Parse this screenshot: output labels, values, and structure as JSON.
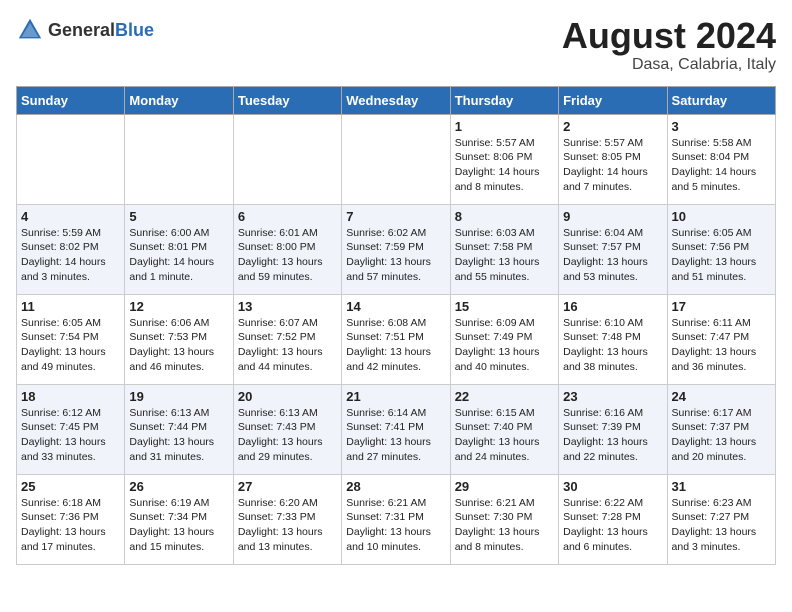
{
  "logo": {
    "general": "General",
    "blue": "Blue"
  },
  "title": {
    "month_year": "August 2024",
    "location": "Dasa, Calabria, Italy"
  },
  "days_of_week": [
    "Sunday",
    "Monday",
    "Tuesday",
    "Wednesday",
    "Thursday",
    "Friday",
    "Saturday"
  ],
  "weeks": [
    [
      {
        "day": "",
        "info": ""
      },
      {
        "day": "",
        "info": ""
      },
      {
        "day": "",
        "info": ""
      },
      {
        "day": "",
        "info": ""
      },
      {
        "day": "1",
        "info": "Sunrise: 5:57 AM\nSunset: 8:06 PM\nDaylight: 14 hours\nand 8 minutes."
      },
      {
        "day": "2",
        "info": "Sunrise: 5:57 AM\nSunset: 8:05 PM\nDaylight: 14 hours\nand 7 minutes."
      },
      {
        "day": "3",
        "info": "Sunrise: 5:58 AM\nSunset: 8:04 PM\nDaylight: 14 hours\nand 5 minutes."
      }
    ],
    [
      {
        "day": "4",
        "info": "Sunrise: 5:59 AM\nSunset: 8:02 PM\nDaylight: 14 hours\nand 3 minutes."
      },
      {
        "day": "5",
        "info": "Sunrise: 6:00 AM\nSunset: 8:01 PM\nDaylight: 14 hours\nand 1 minute."
      },
      {
        "day": "6",
        "info": "Sunrise: 6:01 AM\nSunset: 8:00 PM\nDaylight: 13 hours\nand 59 minutes."
      },
      {
        "day": "7",
        "info": "Sunrise: 6:02 AM\nSunset: 7:59 PM\nDaylight: 13 hours\nand 57 minutes."
      },
      {
        "day": "8",
        "info": "Sunrise: 6:03 AM\nSunset: 7:58 PM\nDaylight: 13 hours\nand 55 minutes."
      },
      {
        "day": "9",
        "info": "Sunrise: 6:04 AM\nSunset: 7:57 PM\nDaylight: 13 hours\nand 53 minutes."
      },
      {
        "day": "10",
        "info": "Sunrise: 6:05 AM\nSunset: 7:56 PM\nDaylight: 13 hours\nand 51 minutes."
      }
    ],
    [
      {
        "day": "11",
        "info": "Sunrise: 6:05 AM\nSunset: 7:54 PM\nDaylight: 13 hours\nand 49 minutes."
      },
      {
        "day": "12",
        "info": "Sunrise: 6:06 AM\nSunset: 7:53 PM\nDaylight: 13 hours\nand 46 minutes."
      },
      {
        "day": "13",
        "info": "Sunrise: 6:07 AM\nSunset: 7:52 PM\nDaylight: 13 hours\nand 44 minutes."
      },
      {
        "day": "14",
        "info": "Sunrise: 6:08 AM\nSunset: 7:51 PM\nDaylight: 13 hours\nand 42 minutes."
      },
      {
        "day": "15",
        "info": "Sunrise: 6:09 AM\nSunset: 7:49 PM\nDaylight: 13 hours\nand 40 minutes."
      },
      {
        "day": "16",
        "info": "Sunrise: 6:10 AM\nSunset: 7:48 PM\nDaylight: 13 hours\nand 38 minutes."
      },
      {
        "day": "17",
        "info": "Sunrise: 6:11 AM\nSunset: 7:47 PM\nDaylight: 13 hours\nand 36 minutes."
      }
    ],
    [
      {
        "day": "18",
        "info": "Sunrise: 6:12 AM\nSunset: 7:45 PM\nDaylight: 13 hours\nand 33 minutes."
      },
      {
        "day": "19",
        "info": "Sunrise: 6:13 AM\nSunset: 7:44 PM\nDaylight: 13 hours\nand 31 minutes."
      },
      {
        "day": "20",
        "info": "Sunrise: 6:13 AM\nSunset: 7:43 PM\nDaylight: 13 hours\nand 29 minutes."
      },
      {
        "day": "21",
        "info": "Sunrise: 6:14 AM\nSunset: 7:41 PM\nDaylight: 13 hours\nand 27 minutes."
      },
      {
        "day": "22",
        "info": "Sunrise: 6:15 AM\nSunset: 7:40 PM\nDaylight: 13 hours\nand 24 minutes."
      },
      {
        "day": "23",
        "info": "Sunrise: 6:16 AM\nSunset: 7:39 PM\nDaylight: 13 hours\nand 22 minutes."
      },
      {
        "day": "24",
        "info": "Sunrise: 6:17 AM\nSunset: 7:37 PM\nDaylight: 13 hours\nand 20 minutes."
      }
    ],
    [
      {
        "day": "25",
        "info": "Sunrise: 6:18 AM\nSunset: 7:36 PM\nDaylight: 13 hours\nand 17 minutes."
      },
      {
        "day": "26",
        "info": "Sunrise: 6:19 AM\nSunset: 7:34 PM\nDaylight: 13 hours\nand 15 minutes."
      },
      {
        "day": "27",
        "info": "Sunrise: 6:20 AM\nSunset: 7:33 PM\nDaylight: 13 hours\nand 13 minutes."
      },
      {
        "day": "28",
        "info": "Sunrise: 6:21 AM\nSunset: 7:31 PM\nDaylight: 13 hours\nand 10 minutes."
      },
      {
        "day": "29",
        "info": "Sunrise: 6:21 AM\nSunset: 7:30 PM\nDaylight: 13 hours\nand 8 minutes."
      },
      {
        "day": "30",
        "info": "Sunrise: 6:22 AM\nSunset: 7:28 PM\nDaylight: 13 hours\nand 6 minutes."
      },
      {
        "day": "31",
        "info": "Sunrise: 6:23 AM\nSunset: 7:27 PM\nDaylight: 13 hours\nand 3 minutes."
      }
    ]
  ]
}
